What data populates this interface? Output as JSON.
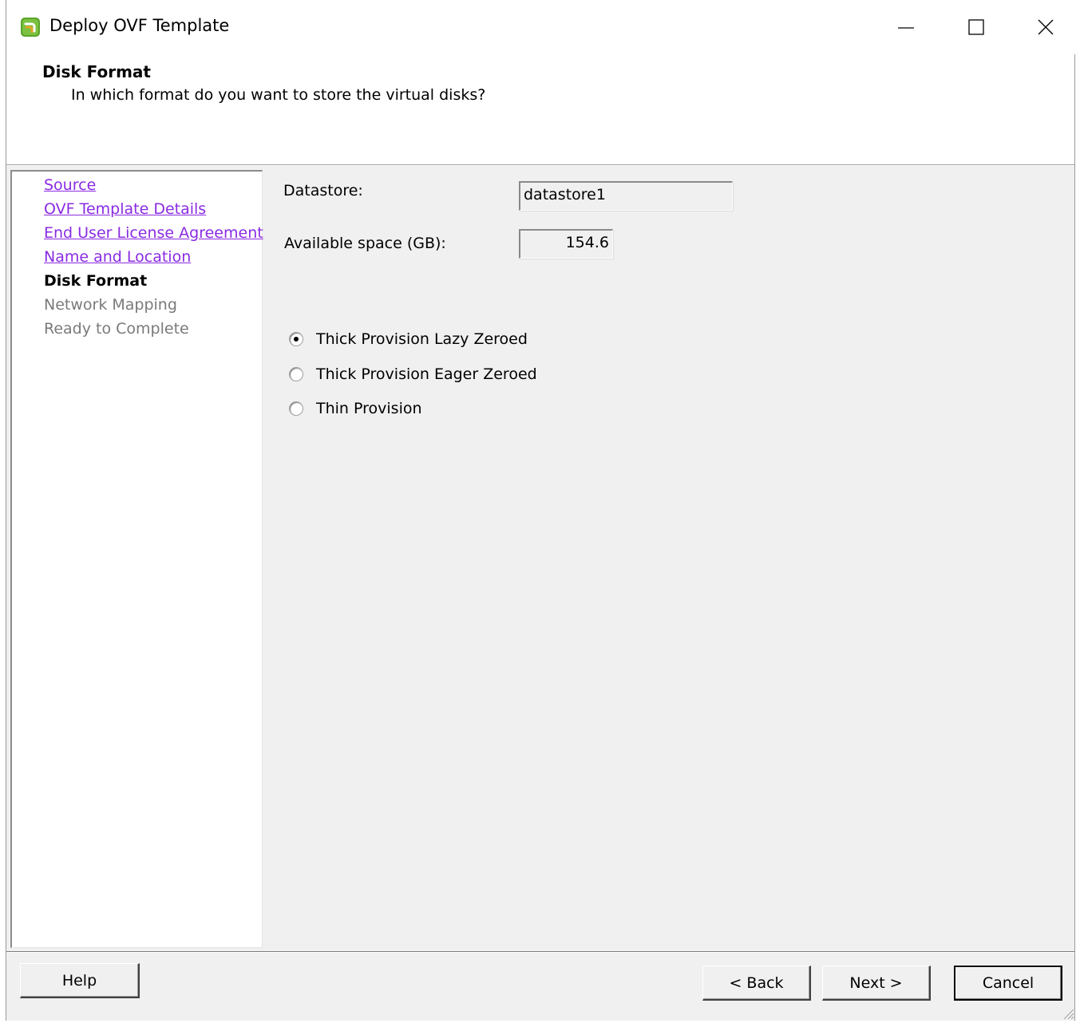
{
  "window": {
    "title": "Deploy OVF Template"
  },
  "header": {
    "title": "Disk Format",
    "subtitle": "In which format do you want to store the virtual disks?"
  },
  "steps": [
    {
      "label": "Source",
      "state": "completed"
    },
    {
      "label": "OVF Template Details",
      "state": "completed"
    },
    {
      "label": "End User License Agreement",
      "state": "completed"
    },
    {
      "label": "Name and Location",
      "state": "completed"
    },
    {
      "label": "Disk Format",
      "state": "current"
    },
    {
      "label": "Network Mapping",
      "state": "future"
    },
    {
      "label": "Ready to Complete",
      "state": "future"
    }
  ],
  "form": {
    "datastore_label": "Datastore:",
    "datastore_value": "datastore1",
    "space_label": "Available space (GB):",
    "space_value": "154.6"
  },
  "disk_options": [
    {
      "label": "Thick Provision Lazy Zeroed",
      "selected": true
    },
    {
      "label": "Thick Provision Eager Zeroed",
      "selected": false
    },
    {
      "label": "Thin Provision",
      "selected": false
    }
  ],
  "buttons": {
    "help": "Help",
    "back": "< Back",
    "next": "Next >",
    "cancel": "Cancel"
  },
  "colors": {
    "link": "#8a2be2",
    "panel_bg": "#f0f0f0",
    "disabled_text": "#7a7a7a"
  },
  "icons": {
    "app": "vmware-vsphere-icon",
    "minimize": "minimize-icon",
    "maximize": "maximize-icon",
    "close": "close-icon",
    "resize": "resize-grip-icon"
  }
}
